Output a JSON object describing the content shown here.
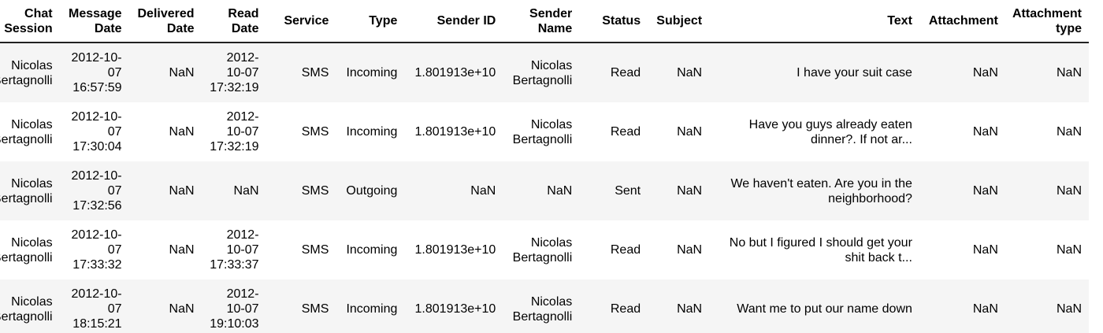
{
  "columns": [
    "Chat Session",
    "Message Date",
    "Delivered Date",
    "Read Date",
    "Service",
    "Type",
    "Sender ID",
    "Sender Name",
    "Status",
    "Subject",
    "Text",
    "Attachment",
    "Attachment type"
  ],
  "rows": [
    [
      "Nicolas Bertagnolli",
      "2012-10-07 16:57:59",
      "NaN",
      "2012-10-07 17:32:19",
      "SMS",
      "Incoming",
      "1.801913e+10",
      "Nicolas Bertagnolli",
      "Read",
      "NaN",
      "I have your suit case",
      "NaN",
      "NaN"
    ],
    [
      "Nicolas Bertagnolli",
      "2012-10-07 17:30:04",
      "NaN",
      "2012-10-07 17:32:19",
      "SMS",
      "Incoming",
      "1.801913e+10",
      "Nicolas Bertagnolli",
      "Read",
      "NaN",
      "Have you guys already eaten dinner?. If not ar...",
      "NaN",
      "NaN"
    ],
    [
      "Nicolas Bertagnolli",
      "2012-10-07 17:32:56",
      "NaN",
      "NaN",
      "SMS",
      "Outgoing",
      "NaN",
      "NaN",
      "Sent",
      "NaN",
      "We haven't eaten. Are you in the neighborhood?",
      "NaN",
      "NaN"
    ],
    [
      "Nicolas Bertagnolli",
      "2012-10-07 17:33:32",
      "NaN",
      "2012-10-07 17:33:37",
      "SMS",
      "Incoming",
      "1.801913e+10",
      "Nicolas Bertagnolli",
      "Read",
      "NaN",
      "No but I figured I should get your shit back t...",
      "NaN",
      "NaN"
    ],
    [
      "Nicolas Bertagnolli",
      "2012-10-07 18:15:21",
      "NaN",
      "2012-10-07 19:10:03",
      "SMS",
      "Incoming",
      "1.801913e+10",
      "Nicolas Bertagnolli",
      "Read",
      "NaN",
      "Want me to put our name down",
      "NaN",
      "NaN"
    ]
  ],
  "colors": {
    "stripe": "#f5f5f5",
    "header_rule": "#222222",
    "text": "#000000"
  }
}
